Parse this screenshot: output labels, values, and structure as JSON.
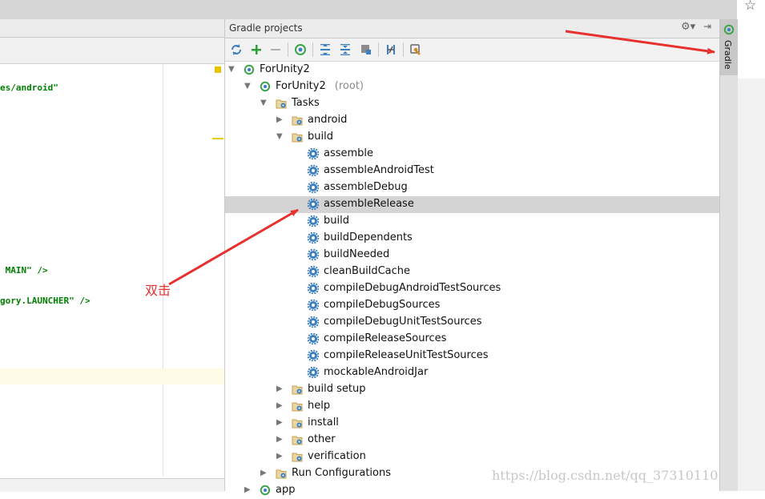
{
  "gradle_panel": {
    "title": "Gradle projects",
    "toolbar": [
      "refresh-icon",
      "add-icon",
      "remove-icon",
      "execute-task-icon",
      "expand-all-icon",
      "collapse-all-icon",
      "offline-mode-icon",
      "toggle-dependency-icon",
      "settings-wrench-icon"
    ]
  },
  "editor": {
    "lines": {
      "l1": "es/android\"",
      "l2": " MAIN\" />",
      "l3": "gory.LAUNCHER\" />"
    }
  },
  "tree": [
    {
      "label": "ForUnity2",
      "suffix": "",
      "type": "project",
      "depth": 0,
      "expanded": true
    },
    {
      "label": "ForUnity2",
      "suffix": " (root)",
      "type": "project",
      "depth": 1,
      "expanded": true
    },
    {
      "label": "Tasks",
      "suffix": "",
      "type": "folder",
      "depth": 2,
      "expanded": true
    },
    {
      "label": "android",
      "suffix": "",
      "type": "folder",
      "depth": 3,
      "expanded": false
    },
    {
      "label": "build",
      "suffix": "",
      "type": "folder",
      "depth": 3,
      "expanded": true
    },
    {
      "label": "assemble",
      "suffix": "",
      "type": "task",
      "depth": 4
    },
    {
      "label": "assembleAndroidTest",
      "suffix": "",
      "type": "task",
      "depth": 4
    },
    {
      "label": "assembleDebug",
      "suffix": "",
      "type": "task",
      "depth": 4
    },
    {
      "label": "assembleRelease",
      "suffix": "",
      "type": "task",
      "depth": 4,
      "selected": true
    },
    {
      "label": "build",
      "suffix": "",
      "type": "task",
      "depth": 4
    },
    {
      "label": "buildDependents",
      "suffix": "",
      "type": "task",
      "depth": 4
    },
    {
      "label": "buildNeeded",
      "suffix": "",
      "type": "task",
      "depth": 4
    },
    {
      "label": "cleanBuildCache",
      "suffix": "",
      "type": "task",
      "depth": 4
    },
    {
      "label": "compileDebugAndroidTestSources",
      "suffix": "",
      "type": "task",
      "depth": 4
    },
    {
      "label": "compileDebugSources",
      "suffix": "",
      "type": "task",
      "depth": 4
    },
    {
      "label": "compileDebugUnitTestSources",
      "suffix": "",
      "type": "task",
      "depth": 4
    },
    {
      "label": "compileReleaseSources",
      "suffix": "",
      "type": "task",
      "depth": 4
    },
    {
      "label": "compileReleaseUnitTestSources",
      "suffix": "",
      "type": "task",
      "depth": 4
    },
    {
      "label": "mockableAndroidJar",
      "suffix": "",
      "type": "task",
      "depth": 4
    },
    {
      "label": "build setup",
      "suffix": "",
      "type": "folder",
      "depth": 3,
      "expanded": false
    },
    {
      "label": "help",
      "suffix": "",
      "type": "folder",
      "depth": 3,
      "expanded": false
    },
    {
      "label": "install",
      "suffix": "",
      "type": "folder",
      "depth": 3,
      "expanded": false
    },
    {
      "label": "other",
      "suffix": "",
      "type": "folder",
      "depth": 3,
      "expanded": false
    },
    {
      "label": "verification",
      "suffix": "",
      "type": "folder",
      "depth": 3,
      "expanded": false
    },
    {
      "label": "Run Configurations",
      "suffix": "",
      "type": "folder",
      "depth": 2,
      "expanded": false
    },
    {
      "label": "app",
      "suffix": "",
      "type": "project",
      "depth": 1,
      "expanded": false
    }
  ],
  "tool_window_tab": "Gradle",
  "annotation": "双击",
  "watermark": "https://blog.csdn.net/qq_37310110",
  "colors": {
    "accent_red": "#e8302f",
    "task_gear": "#3d7fc1",
    "gradle_green": "#3aa64a",
    "folder": "#c9a050",
    "selection": "#d4d4d4"
  }
}
